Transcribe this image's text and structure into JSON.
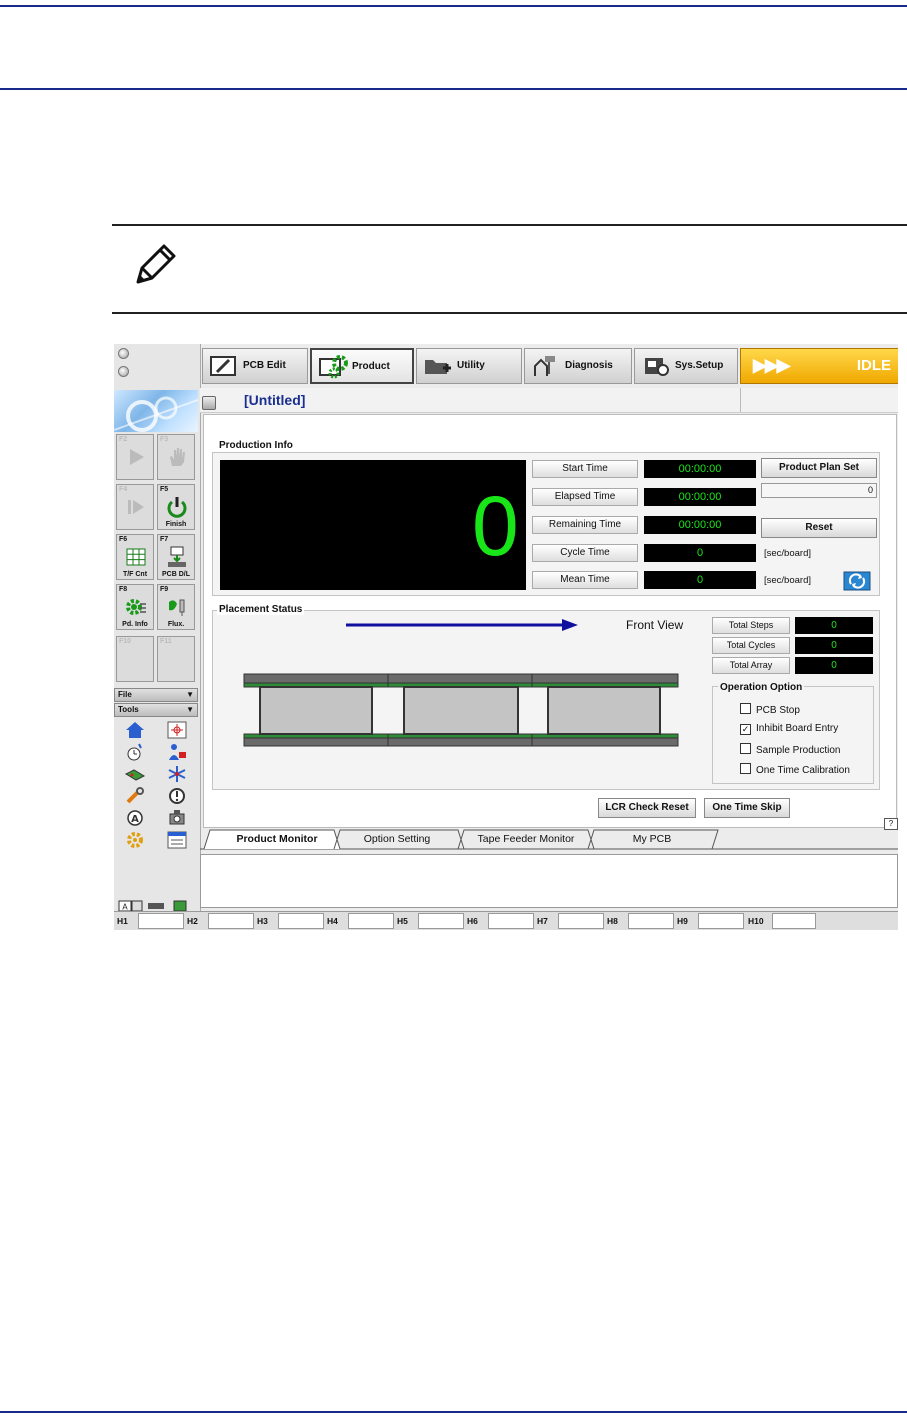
{
  "toolbar": {
    "items": [
      {
        "label": "PCB Edit",
        "icon": "pcb-edit-icon"
      },
      {
        "label": "Product",
        "icon": "product-gear-icon"
      },
      {
        "label": "Utility",
        "icon": "utility-folder-icon"
      },
      {
        "label": "Diagnosis",
        "icon": "diagnosis-icon"
      },
      {
        "label": "Sys.Setup",
        "icon": "sys-setup-icon"
      }
    ],
    "status": "IDLE",
    "status_chevrons": "▶▶▶"
  },
  "document": {
    "title": "[Untitled]"
  },
  "fkeys": [
    {
      "key": "F2",
      "label": "",
      "enabled": false
    },
    {
      "key": "F3",
      "label": "",
      "enabled": false
    },
    {
      "key": "F4",
      "label": "",
      "enabled": false
    },
    {
      "key": "F5",
      "label": "Finish",
      "enabled": true
    },
    {
      "key": "F6",
      "label": "T/F Cnt",
      "enabled": true
    },
    {
      "key": "F7",
      "label": "PCB D/L",
      "enabled": true
    },
    {
      "key": "F8",
      "label": "Pd. Info",
      "enabled": true
    },
    {
      "key": "F9",
      "label": "Flux.",
      "enabled": true
    },
    {
      "key": "F10",
      "label": "",
      "enabled": false
    },
    {
      "key": "F11",
      "label": "",
      "enabled": false
    }
  ],
  "menus": {
    "file": "File",
    "tools": "Tools",
    "arrow": "▼"
  },
  "production_info": {
    "title": "Production Info",
    "count": "0",
    "rows": [
      {
        "label": "Start Time",
        "value": "00:00:00"
      },
      {
        "label": "Elapsed Time",
        "value": "00:00:00"
      },
      {
        "label": "Remaining Time",
        "value": "00:00:00"
      },
      {
        "label": "Cycle Time",
        "value": "0",
        "unit": "[sec/board]"
      },
      {
        "label": "Mean Time",
        "value": "0",
        "unit": "[sec/board]"
      }
    ],
    "plan_button": "Product Plan Set",
    "plan_value": "0",
    "reset_button": "Reset"
  },
  "placement_status": {
    "title": "Placement Status",
    "view_label": "Front View",
    "stats": [
      {
        "label": "Total Steps",
        "value": "0"
      },
      {
        "label": "Total Cycles",
        "value": "0"
      },
      {
        "label": "Total Array",
        "value": "0"
      }
    ],
    "operation_option": {
      "title": "Operation Option",
      "options": [
        {
          "label": "PCB Stop",
          "checked": false
        },
        {
          "label": "Inhibit Board Entry",
          "checked": true
        },
        {
          "label": "Sample Production",
          "checked": false
        },
        {
          "label": "One Time Calibration",
          "checked": false
        }
      ]
    }
  },
  "actions": {
    "lcr_reset": "LCR Check Reset",
    "one_time_skip": "One Time Skip"
  },
  "help_badge": "?",
  "tabs": [
    "Product Monitor",
    "Option Setting",
    "Tape Feeder Monitor",
    "My PCB"
  ],
  "heads": [
    "H1",
    "H2",
    "H3",
    "H4",
    "H5",
    "H6",
    "H7",
    "H8",
    "H9",
    "H10"
  ],
  "colors": {
    "rule": "#1a2a8a",
    "digit_green": "#19e619",
    "title_blue": "#1a2f8f",
    "arrow_blue": "#1010a0",
    "idle_yellow": "#f0a800"
  }
}
